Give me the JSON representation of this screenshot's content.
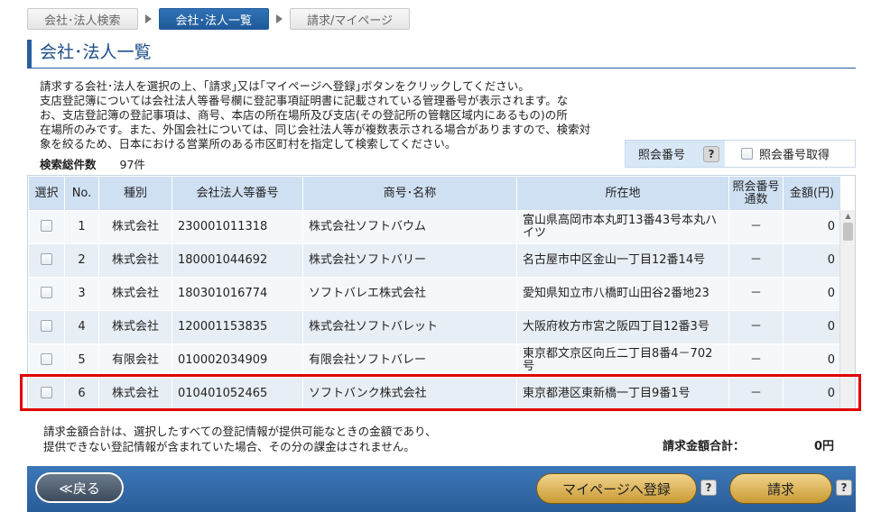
{
  "breadcrumb": [
    "会社･法人検索",
    "会社･法人一覧",
    "請求/マイページ"
  ],
  "page_title": "会社･法人一覧",
  "description": [
    "請求する会社･法人を選択の上、｢請求｣又は｢マイページへ登録｣ボタンをクリックしてください。",
    "支店登記簿については会社法人等番号欄に登記事項証明書に記載されている管理番号が表示されます。な",
    "お、支店登記簿の登記事項は、商号、本店の所在場所及び支店(その登記所の管轄区域内にあるもの)の所",
    "在場所のみです。また、外国会社については、同じ会社法人等が複数表示される場合がありますので、検索対",
    "象を絞るため、日本における営業所のある市区町村を指定して検索してください。"
  ],
  "total": {
    "label": "検索総件数",
    "value": "97件"
  },
  "ref": {
    "label": "照会番号",
    "help": "?",
    "checkbox_label": "照会番号取得"
  },
  "table": {
    "headers": [
      "選択",
      "No.",
      "種別",
      "会社法人等番号",
      "商号･名称",
      "所在地",
      "照会番号通数",
      "金額(円)"
    ],
    "rows": [
      {
        "no": "1",
        "type": "株式会社",
        "number": "230001011318",
        "name": "株式会社ソフトバウム",
        "address": "富山県高岡市本丸町13番43号本丸ハイツ",
        "count": "－",
        "amount": "0"
      },
      {
        "no": "2",
        "type": "株式会社",
        "number": "180001044692",
        "name": "株式会社ソフトバリー",
        "address": "名古屋市中区金山一丁目12番14号",
        "count": "－",
        "amount": "0"
      },
      {
        "no": "3",
        "type": "株式会社",
        "number": "180301016774",
        "name": "ソフトバレエ株式会社",
        "address": "愛知県知立市八橋町山田谷2番地23",
        "count": "－",
        "amount": "0"
      },
      {
        "no": "4",
        "type": "株式会社",
        "number": "120001153835",
        "name": "株式会社ソフトバレット",
        "address": "大阪府枚方市宮之阪四丁目12番3号",
        "count": "－",
        "amount": "0"
      },
      {
        "no": "5",
        "type": "有限会社",
        "number": "010002034909",
        "name": "有限会社ソフトバレー",
        "address": "東京都文京区向丘二丁目8番4－702号",
        "count": "－",
        "amount": "0"
      },
      {
        "no": "6",
        "type": "株式会社",
        "number": "010401052465",
        "name": "ソフトバンク株式会社",
        "address": "東京都港区東新橋一丁目9番1号",
        "count": "－",
        "amount": "0"
      }
    ]
  },
  "note": [
    "請求金額合計は、選択したすべての登記情報が提供可能なときの金額であり、",
    "提供できない登記情報が含まれていた場合、その分の課金はされません。"
  ],
  "sum": {
    "label": "請求金額合計：",
    "value": "0円"
  },
  "footer": {
    "back": "≪戻る",
    "register": "マイページへ登録",
    "request": "請求",
    "help": "?"
  }
}
